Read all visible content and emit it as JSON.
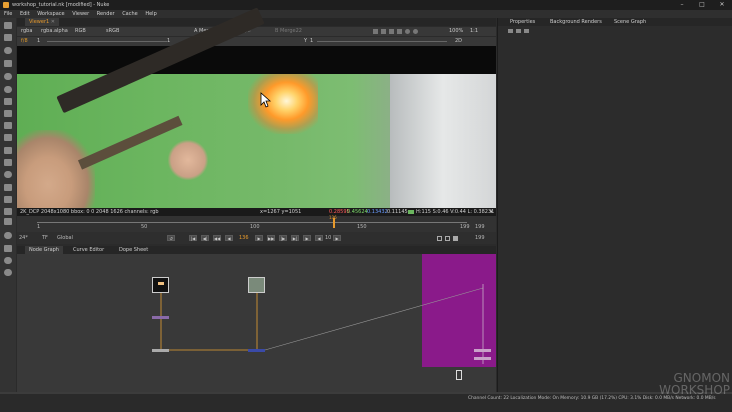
{
  "window": {
    "title": "workshop_tutorial.nk [modified] - Nuke",
    "minimize": "–",
    "maximize": "□",
    "close": "✕"
  },
  "menu": [
    "File",
    "Edit",
    "Workspace",
    "Viewer",
    "Render",
    "Cache",
    "Help"
  ],
  "viewer_tab": {
    "label": "Viewer1",
    "close": "✕"
  },
  "viewer_controls": {
    "channels": "rgba",
    "layer": "rgba.alpha",
    "display": "RGB",
    "colorspace": "sRGB",
    "input_a": "A  Merge22",
    "dash": "-",
    "wipe": "wipe",
    "input_b": "B  Merge22",
    "zoom": "100%",
    "ratio": "1:1",
    "mode": "2D",
    "fstop_label": "f/8",
    "fstop_value": "1",
    "gain": "1",
    "y_label": "Y",
    "y_value": "1"
  },
  "viewer_info": {
    "format": "2K_DCP 2048x1080  bbox: 0 0 2048 1626 channels: rgb",
    "coords": "x=1267 y=1051",
    "r": "0.28595",
    "g": "0.45624",
    "b": "0.13432",
    "a": "0.11145",
    "hsv": "H:115 S:0.46 V:0.44  L: 0.38231"
  },
  "timeline": {
    "start": "1",
    "marks": [
      "50",
      "100",
      "150",
      "199"
    ],
    "current": "136",
    "end": "199",
    "fps": "24*",
    "tf": "TF",
    "global": "Global",
    "frame": "136",
    "inc": "10",
    "end_field": "199"
  },
  "bottom_tabs": [
    "Node Graph",
    "Curve Editor",
    "Dope Sheet"
  ],
  "right_tabs": [
    "Properties",
    "Background Renders",
    "Scene Graph"
  ],
  "status": "Channel Count: 22  Localization Mode: On  Memory: 10.9 GB (17.2%)  CPU: 3.1%  Disk: 0.0 MB/s  Network: 0.0 MB/s",
  "watermark": {
    "line1": "GNOMON",
    "line2": "WORKSHOP"
  },
  "colors": {
    "accent": "#e8a033",
    "nuke_orange": "#e89a2c",
    "green_screen": "#6cb660",
    "magenta": "#8a1a8a"
  }
}
